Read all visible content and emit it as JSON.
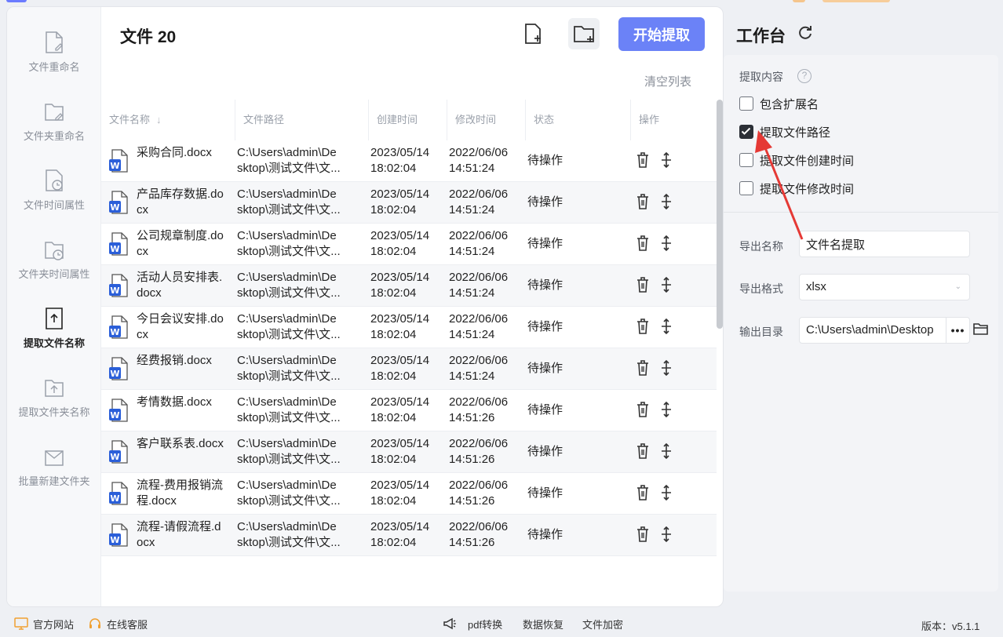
{
  "nav": {
    "items": [
      {
        "label": "文件重命名",
        "icon": "file-edit-icon"
      },
      {
        "label": "文件夹重命名",
        "icon": "folder-edit-icon"
      },
      {
        "label": "文件时间属性",
        "icon": "file-clock-icon"
      },
      {
        "label": "文件夹时间属性",
        "icon": "folder-clock-icon"
      },
      {
        "label": "提取文件名称",
        "icon": "file-upload-icon",
        "active": true
      },
      {
        "label": "提取文件夹名称",
        "icon": "folder-upload-icon"
      },
      {
        "label": "批量新建文件夹",
        "icon": "folder-mail-icon"
      }
    ]
  },
  "header": {
    "title": "文件 20",
    "start_label": "开始提取",
    "clear_label": "清空列表"
  },
  "table": {
    "columns": [
      "文件名称",
      "文件路径",
      "创建时间",
      "修改时间",
      "状态",
      "操作"
    ],
    "rows": [
      {
        "name": "采购合同.docx",
        "path1": "C:\\Users\\admin\\De",
        "path2": "sktop\\测试文件\\文...",
        "cdate": "2023/05/14",
        "ctime": "18:02:04",
        "mdate": "2022/06/06",
        "mtime": "14:51:24",
        "status": "待操作"
      },
      {
        "name": "产品库存数据.docx",
        "path1": "C:\\Users\\admin\\De",
        "path2": "sktop\\测试文件\\文...",
        "cdate": "2023/05/14",
        "ctime": "18:02:04",
        "mdate": "2022/06/06",
        "mtime": "14:51:24",
        "status": "待操作"
      },
      {
        "name": "公司规章制度.docx",
        "path1": "C:\\Users\\admin\\De",
        "path2": "sktop\\测试文件\\文...",
        "cdate": "2023/05/14",
        "ctime": "18:02:04",
        "mdate": "2022/06/06",
        "mtime": "14:51:24",
        "status": "待操作"
      },
      {
        "name": "活动人员安排表.docx",
        "path1": "C:\\Users\\admin\\De",
        "path2": "sktop\\测试文件\\文...",
        "cdate": "2023/05/14",
        "ctime": "18:02:04",
        "mdate": "2022/06/06",
        "mtime": "14:51:24",
        "status": "待操作"
      },
      {
        "name": "今日会议安排.docx",
        "path1": "C:\\Users\\admin\\De",
        "path2": "sktop\\测试文件\\文...",
        "cdate": "2023/05/14",
        "ctime": "18:02:04",
        "mdate": "2022/06/06",
        "mtime": "14:51:24",
        "status": "待操作"
      },
      {
        "name": "经费报销.docx",
        "path1": "C:\\Users\\admin\\De",
        "path2": "sktop\\测试文件\\文...",
        "cdate": "2023/05/14",
        "ctime": "18:02:04",
        "mdate": "2022/06/06",
        "mtime": "14:51:24",
        "status": "待操作"
      },
      {
        "name": "考情数据.docx",
        "path1": "C:\\Users\\admin\\De",
        "path2": "sktop\\测试文件\\文...",
        "cdate": "2023/05/14",
        "ctime": "18:02:04",
        "mdate": "2022/06/06",
        "mtime": "14:51:26",
        "status": "待操作"
      },
      {
        "name": "客户联系表.docx",
        "path1": "C:\\Users\\admin\\De",
        "path2": "sktop\\测试文件\\文...",
        "cdate": "2023/05/14",
        "ctime": "18:02:04",
        "mdate": "2022/06/06",
        "mtime": "14:51:26",
        "status": "待操作"
      },
      {
        "name": "流程-费用报销流程.docx",
        "path1": "C:\\Users\\admin\\De",
        "path2": "sktop\\测试文件\\文...",
        "cdate": "2023/05/14",
        "ctime": "18:02:04",
        "mdate": "2022/06/06",
        "mtime": "14:51:26",
        "status": "待操作"
      },
      {
        "name": "流程-请假流程.docx",
        "path1": "C:\\Users\\admin\\De",
        "path2": "sktop\\测试文件\\文...",
        "cdate": "2023/05/14",
        "ctime": "18:02:04",
        "mdate": "2022/06/06",
        "mtime": "14:51:26",
        "status": "待操作"
      }
    ]
  },
  "workspace": {
    "title": "工作台",
    "extract_label": "提取内容",
    "help": "?",
    "options": [
      {
        "label": "包含扩展名",
        "checked": false
      },
      {
        "label": "提取文件路径",
        "checked": true
      },
      {
        "label": "提取文件创建时间",
        "checked": false
      },
      {
        "label": "提取文件修改时间",
        "checked": false
      }
    ],
    "export_name_label": "导出名称",
    "export_name_value": "文件名提取",
    "export_format_label": "导出格式",
    "export_format_value": "xlsx",
    "output_dir_label": "输出目录",
    "output_dir_value": "C:\\Users\\admin\\Desktop",
    "dots": "•••"
  },
  "footer": {
    "website": "官方网站",
    "service": "在线客服",
    "pdf": "pdf转换",
    "recover": "数据恢复",
    "encrypt": "文件加密",
    "version": "版本：v5.1.1"
  },
  "colors": {
    "accent": "#6b82f7",
    "arrow": "#e53935",
    "word_blue": "#2b5fd9"
  }
}
